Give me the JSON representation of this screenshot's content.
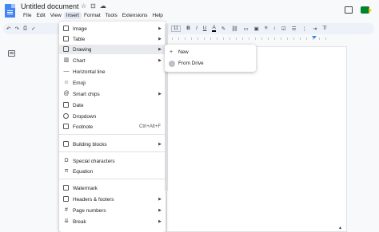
{
  "app": {
    "title": "Untitled document",
    "menus": [
      "File",
      "Edit",
      "View",
      "Insert",
      "Format",
      "Tools",
      "Extensions",
      "Help"
    ],
    "active_menu": "Insert"
  },
  "toolbar": {
    "font_size": "11",
    "bold": "B",
    "italic": "I",
    "underline": "U",
    "text_color": "A"
  },
  "insert_menu": {
    "items": [
      {
        "label": "Image",
        "icon": "image-icon",
        "submenu": true
      },
      {
        "label": "Table",
        "icon": "table-icon",
        "submenu": true
      },
      {
        "label": "Drawing",
        "icon": "drawing-icon",
        "submenu": true,
        "highlighted": true
      },
      {
        "label": "Chart",
        "icon": "chart-icon",
        "submenu": true
      },
      {
        "label": "Horizontal line",
        "icon": "horizontal-line-icon"
      },
      {
        "label": "Emoji",
        "icon": "emoji-icon"
      },
      {
        "label": "Smart chips",
        "icon": "smart-chips-icon",
        "submenu": true
      },
      {
        "label": "Date",
        "icon": "date-icon"
      },
      {
        "label": "Dropdown",
        "icon": "dropdown-icon"
      },
      {
        "label": "Footnote",
        "icon": "footnote-icon",
        "shortcut": "Ctrl+Alt+F"
      },
      {
        "label": "Building blocks",
        "icon": "building-blocks-icon",
        "submenu": true
      },
      {
        "label": "Special characters",
        "icon": "special-characters-icon"
      },
      {
        "label": "Equation",
        "icon": "equation-icon"
      },
      {
        "label": "Watermark",
        "icon": "watermark-icon"
      },
      {
        "label": "Headers & footers",
        "icon": "headers-footers-icon",
        "submenu": true
      },
      {
        "label": "Page numbers",
        "icon": "page-numbers-icon",
        "submenu": true
      },
      {
        "label": "Break",
        "icon": "break-icon",
        "submenu": true
      }
    ]
  },
  "drawing_submenu": {
    "items": [
      {
        "label": "New",
        "icon": "plus-icon"
      },
      {
        "label": "From Drive",
        "icon": "drive-icon"
      }
    ]
  },
  "colors": {
    "accent": "#4285f4",
    "highlight": "#e8eaed",
    "toolbar_bg": "#edf2fa"
  }
}
